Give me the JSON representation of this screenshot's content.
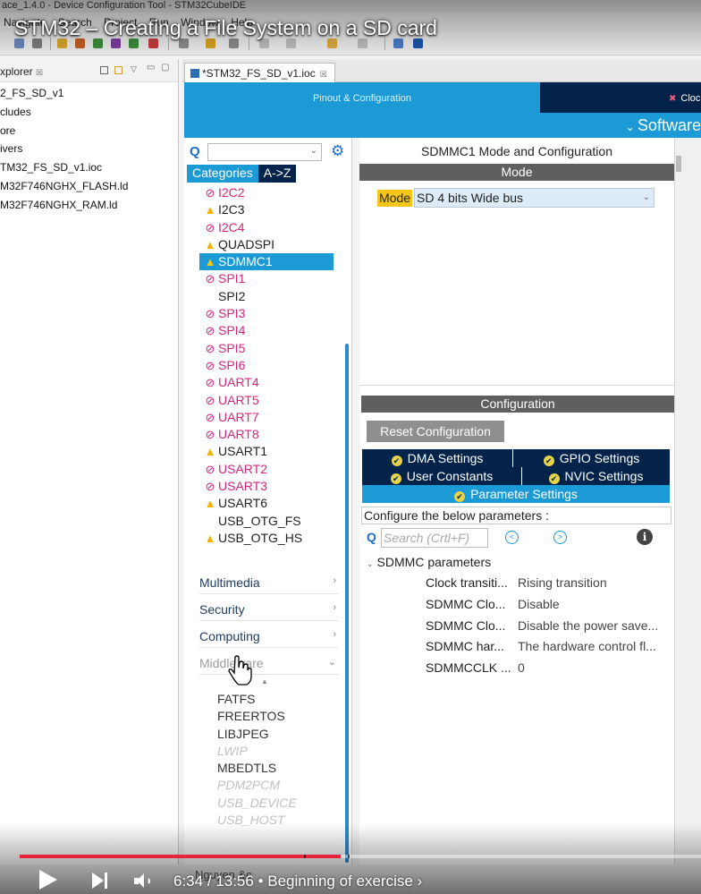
{
  "window": {
    "title": "ace_1.4.0 - Device Configuration Tool - STM32CubeIDE",
    "menu": [
      "Navigate",
      "Search",
      "Project",
      "Run",
      "Window",
      "Help"
    ]
  },
  "video": {
    "title": "STM32 – Creating a File System on a SD card",
    "time_current": "6:34",
    "time_total": "13:56",
    "chapter": "Beginning of exercise",
    "progress": 0.471,
    "accent_color": "#e8243c"
  },
  "explorer": {
    "title": "xplorer",
    "items": [
      "2_FS_SD_v1",
      "cludes",
      "ore",
      "ivers",
      "TM32_FS_SD_v1.ioc",
      "M32F746NGHX_FLASH.ld",
      "M32F746NGHX_RAM.ld"
    ]
  },
  "editor": {
    "tab_label": "*STM32_FS_SD_v1.ioc"
  },
  "ribbon": {
    "tab_pinout": "Pinout & Configuration",
    "tab_clock": "Cloc",
    "software_label": "Software",
    "accent": "#1c9ad6",
    "navy": "#03234b"
  },
  "categories": {
    "tab_categories": "Categories",
    "tab_az": "A->Z",
    "peripherals": [
      {
        "name": "I2C2",
        "status": "disabled"
      },
      {
        "name": "I2C3",
        "status": "warning"
      },
      {
        "name": "I2C4",
        "status": "disabled"
      },
      {
        "name": "QUADSPI",
        "status": "warning"
      },
      {
        "name": "SDMMC1",
        "status": "warning",
        "selected": true
      },
      {
        "name": "SPI1",
        "status": "disabled"
      },
      {
        "name": "SPI2",
        "status": "none"
      },
      {
        "name": "SPI3",
        "status": "disabled"
      },
      {
        "name": "SPI4",
        "status": "disabled"
      },
      {
        "name": "SPI5",
        "status": "disabled"
      },
      {
        "name": "SPI6",
        "status": "disabled"
      },
      {
        "name": "UART4",
        "status": "disabled"
      },
      {
        "name": "UART5",
        "status": "disabled"
      },
      {
        "name": "UART7",
        "status": "disabled"
      },
      {
        "name": "UART8",
        "status": "disabled"
      },
      {
        "name": "USART1",
        "status": "warning"
      },
      {
        "name": "USART2",
        "status": "disabled"
      },
      {
        "name": "USART3",
        "status": "disabled"
      },
      {
        "name": "USART6",
        "status": "warning"
      },
      {
        "name": "USB_OTG_FS",
        "status": "none"
      },
      {
        "name": "USB_OTG_HS",
        "status": "warning"
      }
    ],
    "groups": {
      "multimedia": "Multimedia",
      "security": "Security",
      "computing": "Computing",
      "middleware": "Middleware"
    },
    "middleware_items": [
      {
        "name": "FATFS",
        "available": true
      },
      {
        "name": "FREERTOS",
        "available": true
      },
      {
        "name": "LIBJPEG",
        "available": true
      },
      {
        "name": "LWIP",
        "available": false
      },
      {
        "name": "MBEDTLS",
        "available": true
      },
      {
        "name": "PDM2PCM",
        "available": false
      },
      {
        "name": "USB_DEVICE",
        "available": false
      },
      {
        "name": "USB_HOST",
        "available": false
      }
    ]
  },
  "mode_panel": {
    "title": "SDMMC1 Mode and Configuration",
    "mode_header": "Mode",
    "mode_label": "Mode",
    "mode_value": "SD 4 bits Wide bus"
  },
  "config_panel": {
    "header": "Configuration",
    "reset_button": "Reset Configuration",
    "tabs": {
      "dma": "DMA Settings",
      "gpio": "GPIO Settings",
      "user_constants": "User Constants",
      "nvic": "NVIC Settings",
      "parameters": "Parameter Settings"
    },
    "hint": "Configure the below parameters :",
    "search_placeholder": "Search (Crtl+F)",
    "group_title": "SDMMC parameters",
    "params": [
      {
        "name": "Clock transiti...",
        "value": "Rising transition"
      },
      {
        "name": "SDMMC Clo...",
        "value": "Disable"
      },
      {
        "name": "SDMMC Clo...",
        "value": "Disable the power save..."
      },
      {
        "name": "SDMMC har...",
        "value": "The hardware control fl..."
      },
      {
        "name": "SDMMCCLK ...",
        "value": "0"
      }
    ]
  },
  "bottom": {
    "faded_text": "Nguyen &c"
  }
}
